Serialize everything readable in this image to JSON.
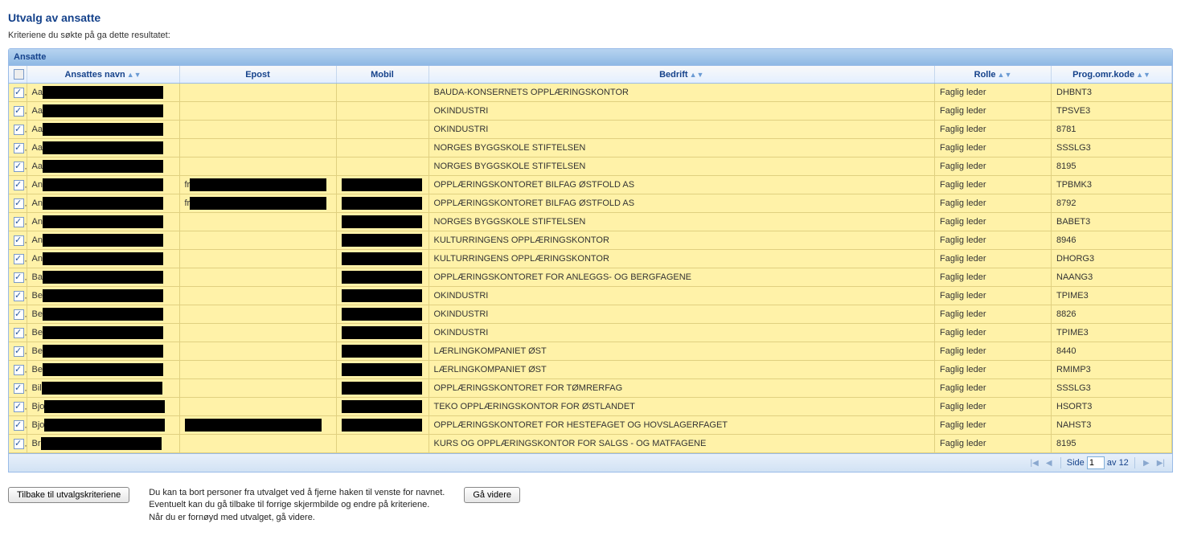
{
  "page": {
    "title": "Utvalg av ansatte",
    "subtitle": "Kriteriene du søkte på ga dette resultatet:"
  },
  "panel": {
    "title": "Ansatte"
  },
  "columns": {
    "name": "Ansattes navn",
    "email": "Epost",
    "mobile": "Mobil",
    "company": "Bedrift",
    "role": "Rolle",
    "code": "Prog.omr.kode"
  },
  "rows": [
    {
      "checked": true,
      "name_prefix": "Aa",
      "email_prefix": "",
      "mobile_redacted": false,
      "company": "BAUDA-KONSERNETS OPPLÆRINGSKONTOR",
      "role": "Faglig leder",
      "code": "DHBNT3"
    },
    {
      "checked": true,
      "name_prefix": "Aa",
      "email_prefix": "",
      "mobile_redacted": false,
      "company": "OKINDUSTRI",
      "role": "Faglig leder",
      "code": "TPSVE3"
    },
    {
      "checked": true,
      "name_prefix": "Aa",
      "email_prefix": "",
      "mobile_redacted": false,
      "company": "OKINDUSTRI",
      "role": "Faglig leder",
      "code": "8781"
    },
    {
      "checked": true,
      "name_prefix": "Aa",
      "email_prefix": "",
      "mobile_redacted": false,
      "company": "NORGES BYGGSKOLE STIFTELSEN",
      "role": "Faglig leder",
      "code": "SSSLG3"
    },
    {
      "checked": true,
      "name_prefix": "Aa",
      "email_prefix": "",
      "mobile_redacted": false,
      "company": "NORGES BYGGSKOLE STIFTELSEN",
      "role": "Faglig leder",
      "code": "8195"
    },
    {
      "checked": true,
      "name_prefix": "An",
      "email_prefix": "fr",
      "mobile_redacted": true,
      "company": "OPPLÆRINGSKONTORET BILFAG ØSTFOLD AS",
      "role": "Faglig leder",
      "code": "TPBMK3"
    },
    {
      "checked": true,
      "name_prefix": "An",
      "email_prefix": "fr",
      "mobile_redacted": true,
      "company": "OPPLÆRINGSKONTORET BILFAG ØSTFOLD AS",
      "role": "Faglig leder",
      "code": "8792"
    },
    {
      "checked": true,
      "name_prefix": "An",
      "email_prefix": "",
      "mobile_redacted": true,
      "company": "NORGES BYGGSKOLE STIFTELSEN",
      "role": "Faglig leder",
      "code": "BABET3"
    },
    {
      "checked": true,
      "name_prefix": "An",
      "email_prefix": "",
      "mobile_redacted": true,
      "company": "KULTURRINGENS OPPLÆRINGSKONTOR",
      "role": "Faglig leder",
      "code": "8946"
    },
    {
      "checked": true,
      "name_prefix": "An",
      "email_prefix": "",
      "mobile_redacted": true,
      "company": "KULTURRINGENS OPPLÆRINGSKONTOR",
      "role": "Faglig leder",
      "code": "DHORG3"
    },
    {
      "checked": true,
      "name_prefix": "Ba",
      "email_prefix": "",
      "mobile_redacted": true,
      "company": "OPPLÆRINGSKONTORET FOR ANLEGGS- OG BERGFAGENE",
      "role": "Faglig leder",
      "code": "NAANG3"
    },
    {
      "checked": true,
      "name_prefix": "Be",
      "email_prefix": "",
      "mobile_redacted": true,
      "company": "OKINDUSTRI",
      "role": "Faglig leder",
      "code": "TPIME3"
    },
    {
      "checked": true,
      "name_prefix": "Be",
      "email_prefix": "",
      "mobile_redacted": true,
      "company": "OKINDUSTRI",
      "role": "Faglig leder",
      "code": "8826"
    },
    {
      "checked": true,
      "name_prefix": "Be",
      "email_prefix": "",
      "mobile_redacted": true,
      "company": "OKINDUSTRI",
      "role": "Faglig leder",
      "code": "TPIME3"
    },
    {
      "checked": true,
      "name_prefix": "Be",
      "email_prefix": "",
      "mobile_redacted": true,
      "company": "LÆRLINGKOMPANIET ØST",
      "role": "Faglig leder",
      "code": "8440"
    },
    {
      "checked": true,
      "name_prefix": "Be",
      "email_prefix": "",
      "mobile_redacted": true,
      "company": "LÆRLINGKOMPANIET ØST",
      "role": "Faglig leder",
      "code": "RMIMP3"
    },
    {
      "checked": true,
      "name_prefix": "Bil",
      "email_prefix": "",
      "mobile_redacted": true,
      "company": "OPPLÆRINGSKONTORET FOR TØMRERFAG",
      "role": "Faglig leder",
      "code": "SSSLG3"
    },
    {
      "checked": true,
      "name_prefix": "Bjo",
      "email_prefix": "",
      "mobile_redacted": true,
      "company": "TEKO OPPLÆRINGSKONTOR FOR ØSTLANDET",
      "role": "Faglig leder",
      "code": "HSORT3"
    },
    {
      "checked": true,
      "name_prefix": "Bjo",
      "email_prefix": "redacted",
      "mobile_redacted": true,
      "company": "OPPLÆRINGSKONTORET FOR HESTEFAGET OG HOVSLAGERFAGET",
      "role": "Faglig leder",
      "code": "NAHST3"
    },
    {
      "checked": true,
      "name_prefix": "Br",
      "email_prefix": "",
      "mobile_redacted": false,
      "company": "KURS OG OPPLÆRINGSKONTOR FOR SALGS - OG MATFAGENE",
      "role": "Faglig leder",
      "code": "8195"
    }
  ],
  "pager": {
    "side_label": "Side",
    "page": "1",
    "of_label": "av 12"
  },
  "buttons": {
    "back": "Tilbake til utvalgskriteriene",
    "next": "Gå videre"
  },
  "help": {
    "line1": "Du kan ta bort personer fra utvalget ved å fjerne haken til venste for navnet.",
    "line2": "Eventuelt kan du gå tilbake til forrige skjermbilde og endre på kriteriene.",
    "line3": "Når du er fornøyd med utvalget, gå videre."
  }
}
